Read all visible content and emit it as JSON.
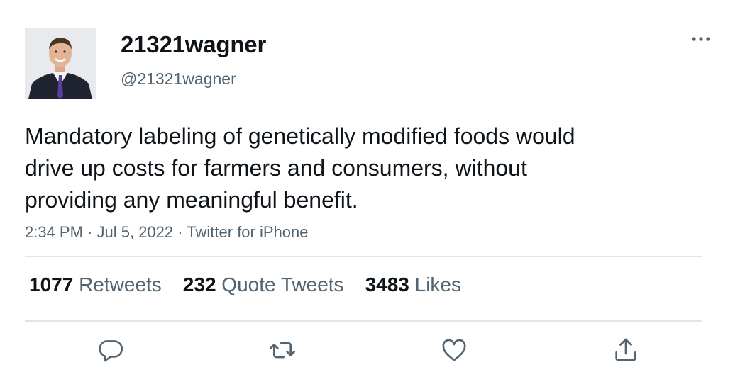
{
  "author": {
    "display_name": "21321wagner",
    "handle": "@21321wagner",
    "avatar_icon": "profile-photo"
  },
  "tweet": {
    "text_lines": [
      "Mandatory labeling of genetically modified foods would",
      "drive up costs for farmers and consumers, without",
      "providing any meaningful benefit."
    ],
    "time": "2:34 PM",
    "date": "Jul 5, 2022",
    "source": "Twitter for iPhone",
    "separator": " · "
  },
  "stats": {
    "retweets": {
      "count": "1077",
      "label": "Retweets"
    },
    "quotes": {
      "count": "232",
      "label": "Quote Tweets"
    },
    "likes": {
      "count": "3483",
      "label": "Likes"
    }
  },
  "actions": [
    "reply-icon",
    "retweet-icon",
    "like-icon",
    "share-icon"
  ],
  "colors": {
    "text": "#0f1419",
    "secondary": "#536471",
    "divider": "#e1e4e8"
  }
}
